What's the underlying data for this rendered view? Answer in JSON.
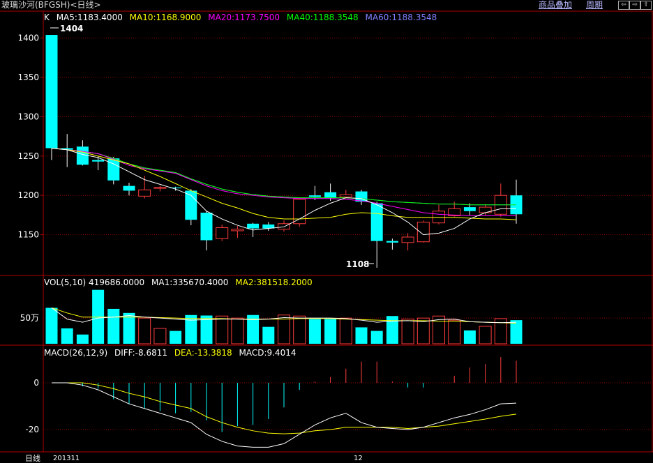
{
  "window": {
    "title": "玻璃沙河(BFGSH)<日线>",
    "menu_overlay": "商品叠加",
    "menu_period": "周期",
    "nav_buttons": [
      "⇦",
      "⇨",
      "⇧"
    ]
  },
  "price_panel": {
    "legend": {
      "k": "K",
      "ma5": "MA5:1183.4000",
      "ma10": "MA10:1168.9000",
      "ma20": "MA20:1173.7500",
      "ma40": "MA40:1188.3548",
      "ma60": "MA60:1188.3548"
    },
    "y_ticks": [
      "1400",
      "1350",
      "1300",
      "1250",
      "1200",
      "1150"
    ],
    "high_label": "1404",
    "low_label": "1108"
  },
  "volume_panel": {
    "legend": {
      "vol": "VOL(5,10) 419686.0000",
      "ma1": "MA1:335670.4000",
      "ma2": "MA2:381518.2000"
    },
    "y_ticks": [
      "50万"
    ]
  },
  "macd_panel": {
    "legend": {
      "macd_params": "MACD(26,12,9)",
      "diff": "DIFF:-8.6811",
      "dea": "DEA:-13.3818",
      "macd": "MACD:9.4014"
    },
    "y_ticks": [
      "0",
      "-20"
    ]
  },
  "x_axis": {
    "period_label": "日线",
    "tick_1": "201311",
    "tick_2": "12"
  },
  "colors": {
    "up": "#ff3c3c",
    "down": "#00ffff",
    "ma5": "#ffffff",
    "ma10": "#ffff00",
    "ma20": "#ff00ff",
    "ma40": "#00ff00",
    "ma60": "#8080ff",
    "grid": "#8b0000"
  },
  "chart_data": {
    "type": "candlestick",
    "candles": [
      {
        "o": 1404,
        "c": 1260,
        "h": 1404,
        "l": 1245
      },
      {
        "o": 1260,
        "c": 1258,
        "h": 1278,
        "l": 1236
      },
      {
        "o": 1262,
        "c": 1239,
        "h": 1270,
        "l": 1238
      },
      {
        "o": 1245,
        "c": 1243,
        "h": 1250,
        "l": 1232
      },
      {
        "o": 1247,
        "c": 1219,
        "h": 1249,
        "l": 1214
      },
      {
        "o": 1212,
        "c": 1206,
        "h": 1216,
        "l": 1200
      },
      {
        "o": 1199,
        "c": 1207,
        "h": 1225,
        "l": 1196
      },
      {
        "o": 1209,
        "c": 1210,
        "h": 1212,
        "l": 1205
      },
      {
        "o": 1210,
        "c": 1209,
        "h": 1211,
        "l": 1206
      },
      {
        "o": 1206,
        "c": 1169,
        "h": 1208,
        "l": 1162
      },
      {
        "o": 1178,
        "c": 1143,
        "h": 1180,
        "l": 1130
      },
      {
        "o": 1145,
        "c": 1159,
        "h": 1163,
        "l": 1142
      },
      {
        "o": 1155,
        "c": 1157,
        "h": 1161,
        "l": 1146
      },
      {
        "o": 1164,
        "c": 1158,
        "h": 1165,
        "l": 1147
      },
      {
        "o": 1163,
        "c": 1158,
        "h": 1166,
        "l": 1155
      },
      {
        "o": 1157,
        "c": 1164,
        "h": 1168,
        "l": 1154
      },
      {
        "o": 1164,
        "c": 1195,
        "h": 1196,
        "l": 1160
      },
      {
        "o": 1200,
        "c": 1198,
        "h": 1212,
        "l": 1194
      },
      {
        "o": 1204,
        "c": 1197,
        "h": 1215,
        "l": 1193
      },
      {
        "o": 1198,
        "c": 1201,
        "h": 1207,
        "l": 1196
      },
      {
        "o": 1205,
        "c": 1192,
        "h": 1207,
        "l": 1188
      },
      {
        "o": 1190,
        "c": 1142,
        "h": 1192,
        "l": 1108
      },
      {
        "o": 1142,
        "c": 1140,
        "h": 1145,
        "l": 1131
      },
      {
        "o": 1140,
        "c": 1147,
        "h": 1152,
        "l": 1130
      },
      {
        "o": 1141,
        "c": 1166,
        "h": 1168,
        "l": 1140
      },
      {
        "o": 1165,
        "c": 1180,
        "h": 1188,
        "l": 1163
      },
      {
        "o": 1174,
        "c": 1183,
        "h": 1192,
        "l": 1173
      },
      {
        "o": 1185,
        "c": 1180,
        "h": 1190,
        "l": 1175
      },
      {
        "o": 1178,
        "c": 1185,
        "h": 1189,
        "l": 1175
      },
      {
        "o": 1176,
        "c": 1200,
        "h": 1215,
        "l": 1173
      },
      {
        "o": 1200,
        "c": 1176,
        "h": 1220,
        "l": 1164
      }
    ],
    "ma5": [
      1260,
      1258,
      1252,
      1248,
      1240,
      1230,
      1220,
      1214,
      1208,
      1200,
      1180,
      1170,
      1162,
      1156,
      1158,
      1160,
      1170,
      1181,
      1190,
      1197,
      1196,
      1188,
      1178,
      1166,
      1150,
      1152,
      1158,
      1170,
      1178,
      1183,
      1183
    ],
    "ma10": [
      1260,
      1258,
      1255,
      1250,
      1245,
      1240,
      1232,
      1224,
      1215,
      1206,
      1198,
      1190,
      1184,
      1177,
      1172,
      1170,
      1170,
      1171,
      1172,
      1176,
      1178,
      1177,
      1174,
      1172,
      1172,
      1172,
      1172,
      1171,
      1170,
      1170,
      1169
    ],
    "ma20": [
      1260,
      1258,
      1256,
      1253,
      1246,
      1238,
      1234,
      1231,
      1228,
      1220,
      1212,
      1206,
      1202,
      1200,
      1198,
      1197,
      1196,
      1196,
      1196,
      1195,
      1193,
      1190,
      1186,
      1182,
      1178,
      1176,
      1175,
      1174,
      1174,
      1174,
      1174
    ],
    "ma40": [
      1260,
      1258,
      1256,
      1253,
      1247,
      1240,
      1235,
      1232,
      1229,
      1221,
      1214,
      1208,
      1204,
      1201,
      1199,
      1198,
      1197,
      1197,
      1197,
      1197,
      1196,
      1194,
      1192,
      1191,
      1190,
      1189,
      1189,
      1188,
      1188,
      1188,
      1188
    ],
    "ma60": [
      1260,
      1258,
      1256,
      1253,
      1247,
      1240,
      1235,
      1232,
      1229,
      1221,
      1214,
      1208,
      1204,
      1201,
      1199,
      1198,
      1197,
      1197,
      1197,
      1197,
      1196,
      1194,
      1192,
      1191,
      1190,
      1189,
      1189,
      1188,
      1188,
      1188,
      1188
    ],
    "volume": [
      700000,
      300000,
      180000,
      1050000,
      680000,
      600000,
      500000,
      300000,
      250000,
      560000,
      550000,
      540000,
      500000,
      560000,
      330000,
      560000,
      540000,
      480000,
      480000,
      500000,
      320000,
      250000,
      540000,
      480000,
      500000,
      540000,
      460000,
      260000,
      340000,
      490000,
      460000
    ],
    "vol_ma1": [
      700000,
      480000,
      420000,
      500000,
      520000,
      550000,
      520000,
      500000,
      480000,
      460000,
      470000,
      480000,
      480000,
      470000,
      480000,
      510000,
      500000,
      500000,
      500000,
      490000,
      460000,
      420000,
      440000,
      450000,
      430000,
      470000,
      480000,
      430000,
      420000,
      410000,
      420000
    ],
    "vol_ma2": [
      700000,
      600000,
      520000,
      520000,
      520000,
      520000,
      520000,
      510000,
      500000,
      490000,
      490000,
      490000,
      480000,
      480000,
      480000,
      480000,
      490000,
      490000,
      490000,
      480000,
      470000,
      460000,
      450000,
      450000,
      450000,
      440000,
      440000,
      430000,
      420000,
      410000,
      400000
    ],
    "diff": [
      0,
      0,
      -1,
      -3,
      -6,
      -9,
      -11,
      -13,
      -15,
      -17,
      -22,
      -25,
      -27,
      -27.5,
      -27.5,
      -26,
      -22,
      -18,
      -15,
      -13,
      -17,
      -19,
      -19.5,
      -20,
      -19,
      -17,
      -15,
      -13.5,
      -11.5,
      -9,
      -8.6811
    ],
    "dea": [
      0,
      0,
      0,
      -1,
      -2.5,
      -4.5,
      -6,
      -8,
      -9.5,
      -11,
      -14.5,
      -17,
      -19,
      -20.5,
      -21.5,
      -21.8,
      -21.5,
      -20.5,
      -20,
      -19,
      -19,
      -19,
      -19,
      -19.5,
      -19,
      -18.5,
      -17.5,
      -16.5,
      -15.5,
      -14.3,
      -13.3818
    ],
    "macd_bar": [
      0,
      0,
      -1.5,
      -2.5,
      -7,
      -9,
      -11,
      -12,
      -13,
      -12.5,
      -16,
      -21,
      -18.5,
      -18,
      -15.5,
      -10.5,
      -3,
      0.5,
      2.5,
      6,
      9,
      9,
      0.5,
      -2,
      -2,
      0,
      3,
      6.5,
      8,
      11,
      9.4014
    ],
    "price_ylim": [
      1100,
      1420
    ],
    "volume_ylim": [
      0,
      1100000
    ],
    "macd_ylim": [
      -28,
      11
    ]
  }
}
